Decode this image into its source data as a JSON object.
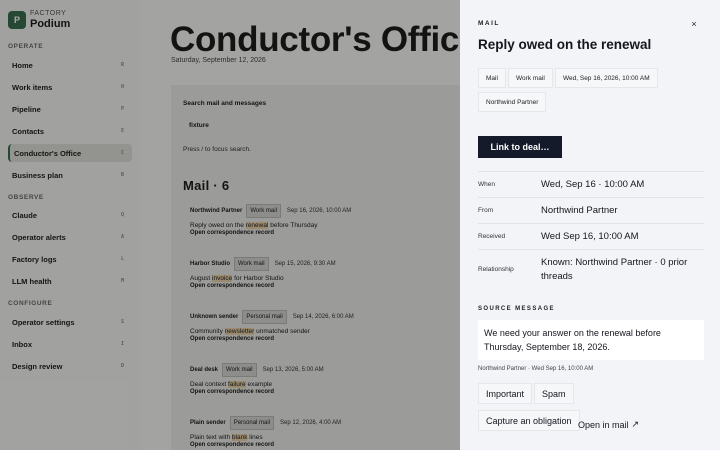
{
  "sidebar": {
    "brand_kicker": "FACTORY",
    "brand_name": "Podium",
    "brand_initial": "P",
    "sections": {
      "operate": "OPERATE",
      "observe": "OBSERVE",
      "configure": "CONFIGURE"
    },
    "items": [
      {
        "label": "Home",
        "key": "R"
      },
      {
        "label": "Work items",
        "key": "H"
      },
      {
        "label": "Pipeline",
        "key": "P"
      },
      {
        "label": "Contacts",
        "key": "E"
      },
      {
        "label": "Conductor's Office",
        "key": "C"
      },
      {
        "label": "Business plan",
        "key": "B"
      },
      {
        "label": "Claude",
        "key": "Q"
      },
      {
        "label": "Operator alerts",
        "key": "A"
      },
      {
        "label": "Factory logs",
        "key": "L"
      },
      {
        "label": "LLM health",
        "key": "M"
      },
      {
        "label": "Operator settings",
        "key": "S"
      },
      {
        "label": "Inbox",
        "key": "I"
      },
      {
        "label": "Design review",
        "key": "D"
      }
    ]
  },
  "main": {
    "title": "Conductor's Office",
    "date": "Saturday, September 12, 2026",
    "search": {
      "title": "Search mail and messages",
      "value": "fixture",
      "hint": "Press / to focus search."
    },
    "mail_heading": "Mail · 6",
    "mail_items": [
      {
        "sender": "Northwind Partner",
        "tag": "Work mail",
        "date": "Sep 16, 2026, 10:00 AM",
        "subject_pre": "Reply owed on the ",
        "subject_hl": "renewal",
        "subject_post": " before Thursday",
        "open": "Open correspondence record"
      },
      {
        "sender": "Harbor Studio",
        "tag": "Work mail",
        "date": "Sep 15, 2026, 9:30 AM",
        "subject_pre": "August ",
        "subject_hl": "invoice",
        "subject_post": " for Harbor Studio",
        "open": "Open correspondence record"
      },
      {
        "sender": "Unknown sender",
        "tag": "Personal mail",
        "date": "Sep 14, 2026, 6:00 AM",
        "subject_pre": "Community ",
        "subject_hl": "newsletter",
        "subject_post": " unmatched sender",
        "open": "Open correspondence record"
      },
      {
        "sender": "Deal desk",
        "tag": "Work mail",
        "date": "Sep 13, 2026, 5:00 AM",
        "subject_pre": "Deal context ",
        "subject_hl": "failure",
        "subject_post": " example",
        "open": "Open correspondence record"
      },
      {
        "sender": "Plain sender",
        "tag": "Personal mail",
        "date": "Sep 12, 2026, 4:00 AM",
        "subject_pre": "Plain text with ",
        "subject_hl": "blank",
        "subject_post": " lines",
        "open": "Open correspondence record"
      }
    ]
  },
  "drawer": {
    "kicker": "MAIL",
    "close": "×",
    "title": "Reply owed on the renewal",
    "chips": [
      "Mail",
      "Work mail",
      "Wed, Sep 16, 2026, 10:00 AM",
      "Northwind Partner"
    ],
    "link_deal": "Link to deal…",
    "fields": [
      {
        "label": "When",
        "value": "Wed, Sep 16 · 10:00 AM"
      },
      {
        "label": "From",
        "value": "Northwind Partner"
      },
      {
        "label": "Received",
        "value": "Wed Sep 16, 10:00 AM"
      },
      {
        "label": "Relationship",
        "value": "Known: Northwind Partner · 0 prior threads"
      }
    ],
    "source_label": "SOURCE MESSAGE",
    "source_text": "We need your answer on the renewal before Thursday, September 18, 2026.",
    "source_meta": "Northwind Partner · Wed Sep 16, 10:00 AM",
    "actions": {
      "important": "Important",
      "spam": "Spam",
      "capture": "Capture an obligation",
      "open_in_mail": "Open in mail",
      "open_arrow": "↗"
    }
  },
  "colors": {
    "brand": "#3b6b4f",
    "primary_button": "#141a2a",
    "highlight": "#e7cfa5"
  }
}
